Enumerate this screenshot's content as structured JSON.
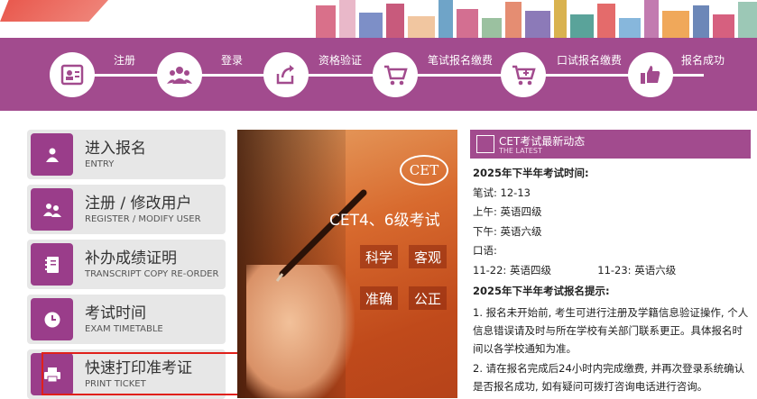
{
  "steps": [
    {
      "label": "注册",
      "icon": "profile-card-icon"
    },
    {
      "label": "登录",
      "icon": "users-group-icon"
    },
    {
      "label": "资格验证",
      "icon": "verify-arrow-icon"
    },
    {
      "label": "笔试报名缴费",
      "icon": "cart-icon"
    },
    {
      "label": "口试报名缴费",
      "icon": "cart-plus-icon"
    },
    {
      "label": "报名成功",
      "icon": "thumbs-up-icon"
    }
  ],
  "menu": [
    {
      "cn": "进入报名",
      "en": "ENTRY",
      "icon": "user-icon"
    },
    {
      "cn": "注册 / 修改用户",
      "en": "REGISTER / MODIFY USER",
      "icon": "users-icon"
    },
    {
      "cn": "补办成绩证明",
      "en": "TRANSCRIPT COPY RE-ORDER",
      "icon": "notebook-icon"
    },
    {
      "cn": "考试时间",
      "en": "EXAM TIMETABLE",
      "icon": "clock-icon"
    },
    {
      "cn": "快速打印准考证",
      "en": "PRINT TICKET",
      "icon": "printer-icon"
    }
  ],
  "promo": {
    "logo": "CET",
    "title": "CET4、6级考试",
    "tags": [
      "科学",
      "客观",
      "准确",
      "公正"
    ]
  },
  "news": {
    "title": "CET考试最新动态",
    "subtitle": "THE LATEST",
    "time_heading": "2025年下半年考试时间:",
    "written": "笔试: 12-13",
    "morning": "上午:  英语四级",
    "afternoon": "下午:  英语六级",
    "oral_label": "口语:",
    "oral_day1": "11-22:  英语四级",
    "oral_day2": "11-23:  英语六级",
    "tips_heading": "2025年下半年考试报名提示:",
    "tip1": "1. 报名未开始前, 考生可进行注册及学籍信息验证操作, 个人信息错误请及时与所在学校有关部门联系更正。具体报名时间以各学校通知为准。",
    "tip2": "2. 请在报名完成后24小时内完成缴费, 并再次登录系统确认是否报名成功, 如有疑问可拨打咨询电话进行咨询。"
  },
  "colors": {
    "brand": "#a24b8e",
    "menu_bg": "#e7e7e7",
    "highlight": "#e0201a"
  }
}
